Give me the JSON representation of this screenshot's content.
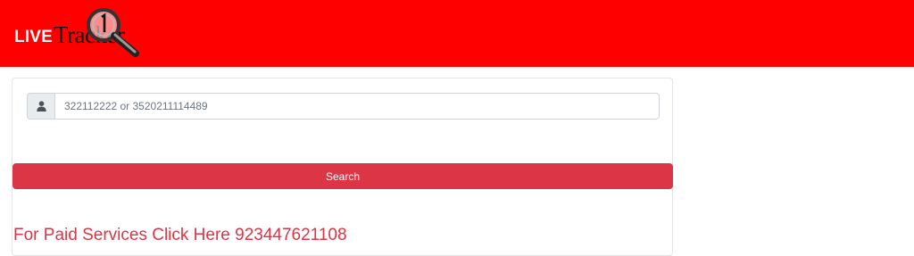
{
  "header": {
    "logo_live": "LIVE",
    "logo_tracker": "Tracker",
    "background_color": "#ff0000"
  },
  "search": {
    "icon": "user-icon",
    "placeholder": "322112222 or 3520211114489",
    "value": "",
    "button_label": "Search",
    "button_color": "#dc3545"
  },
  "paid_services": {
    "text": "For Paid Services Click Here 923447621108",
    "color": "#dc3545"
  }
}
